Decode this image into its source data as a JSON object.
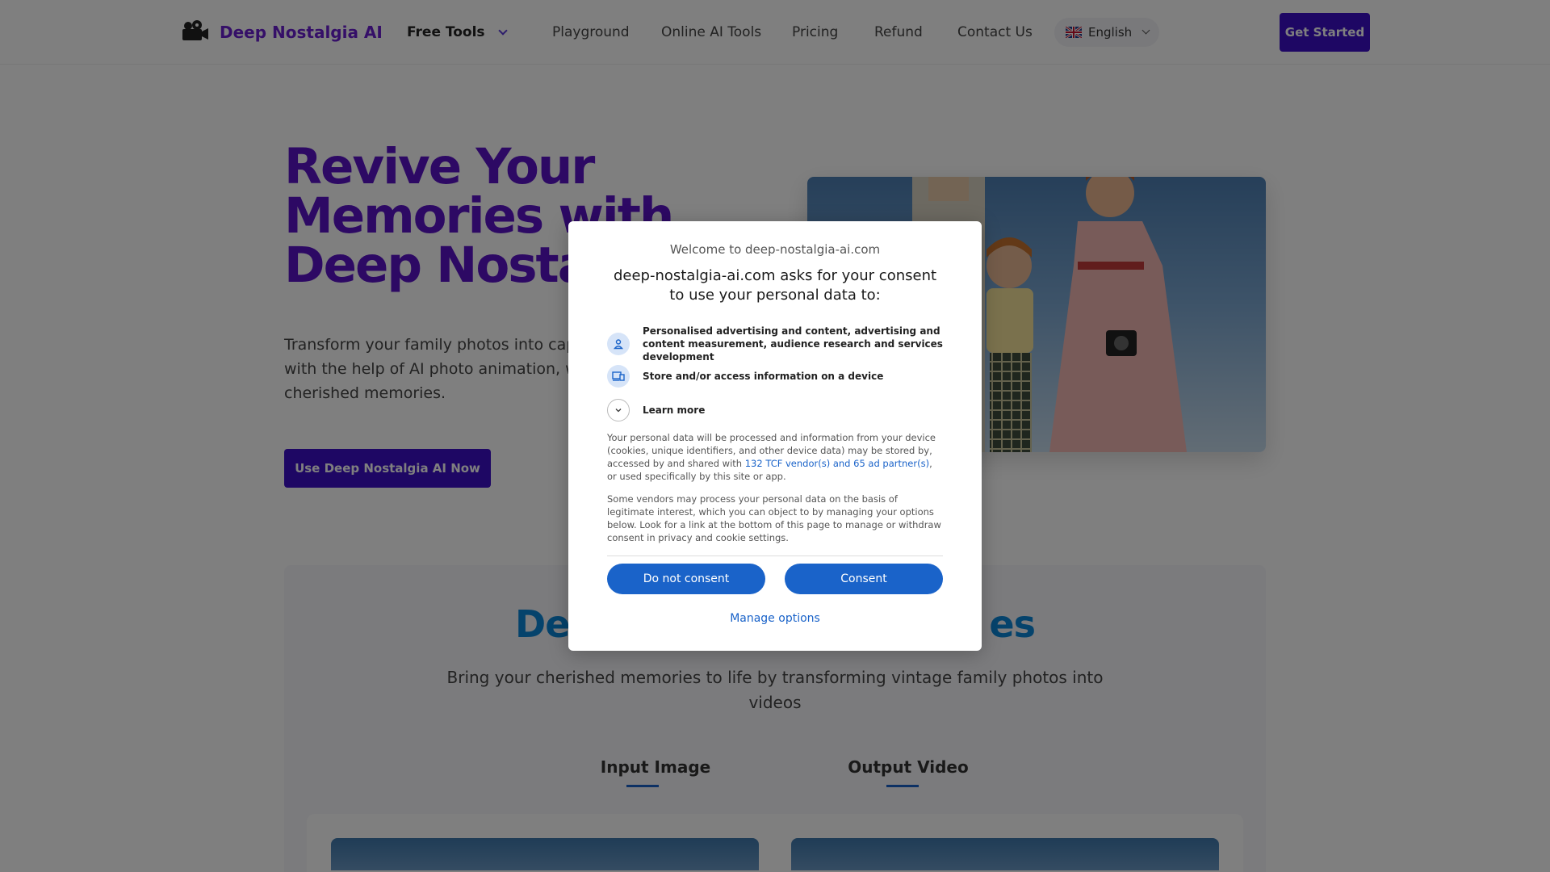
{
  "nav": {
    "logo_text": "Deep Nostalgia AI",
    "items": [
      {
        "label": "Free Tools"
      },
      {
        "label": "Playground"
      },
      {
        "label": "Online AI Tools"
      },
      {
        "label": "Pricing"
      },
      {
        "label": "Refund"
      },
      {
        "label": "Contact Us"
      }
    ],
    "language": "English",
    "cta": "Get Started"
  },
  "hero": {
    "title_lines": [
      "Revive Your",
      "Memories with",
      "Deep Nostalg"
    ],
    "desc_lines": [
      "Transform your family photos into captiva",
      "with the help of AI photo animation, which",
      "cherished memories."
    ],
    "cta": "Use Deep Nostalgia AI Now"
  },
  "section2": {
    "title_left": "De",
    "title_right": "es",
    "subtitle": "Bring your cherished memories to life by transforming vintage family photos into videos",
    "tab_input": "Input Image",
    "tab_output": "Output Video"
  },
  "consent": {
    "welcome": "Welcome to deep-nostalgia-ai.com",
    "heading": "deep-nostalgia-ai.com asks for your consent to use your personal data to:",
    "purpose_1": "Personalised advertising and content, advertising and content measurement, audience research and services development",
    "purpose_2": "Store and/or access information on a device",
    "learn_more": "Learn more",
    "para1_a": "Your personal data will be processed and information from your device (cookies, unique identifiers, and other device data) may be stored by, accessed by and shared with ",
    "para1_link": "132 TCF vendor(s) and 65 ad partner(s)",
    "para1_b": ", or used specifically by this site or app.",
    "para2": "Some vendors may process your personal data on the basis of legitimate interest, which you can object to by managing your options below. Look for a link at the bottom of this page to manage or withdraw consent in privacy and cookie settings.",
    "do_not_consent": "Do not consent",
    "consent": "Consent",
    "manage_options": "Manage options"
  },
  "colors": {
    "brand_purple": "#3d0ec9",
    "title_purple": "#5a12c8",
    "consent_blue": "#1a63c9"
  }
}
